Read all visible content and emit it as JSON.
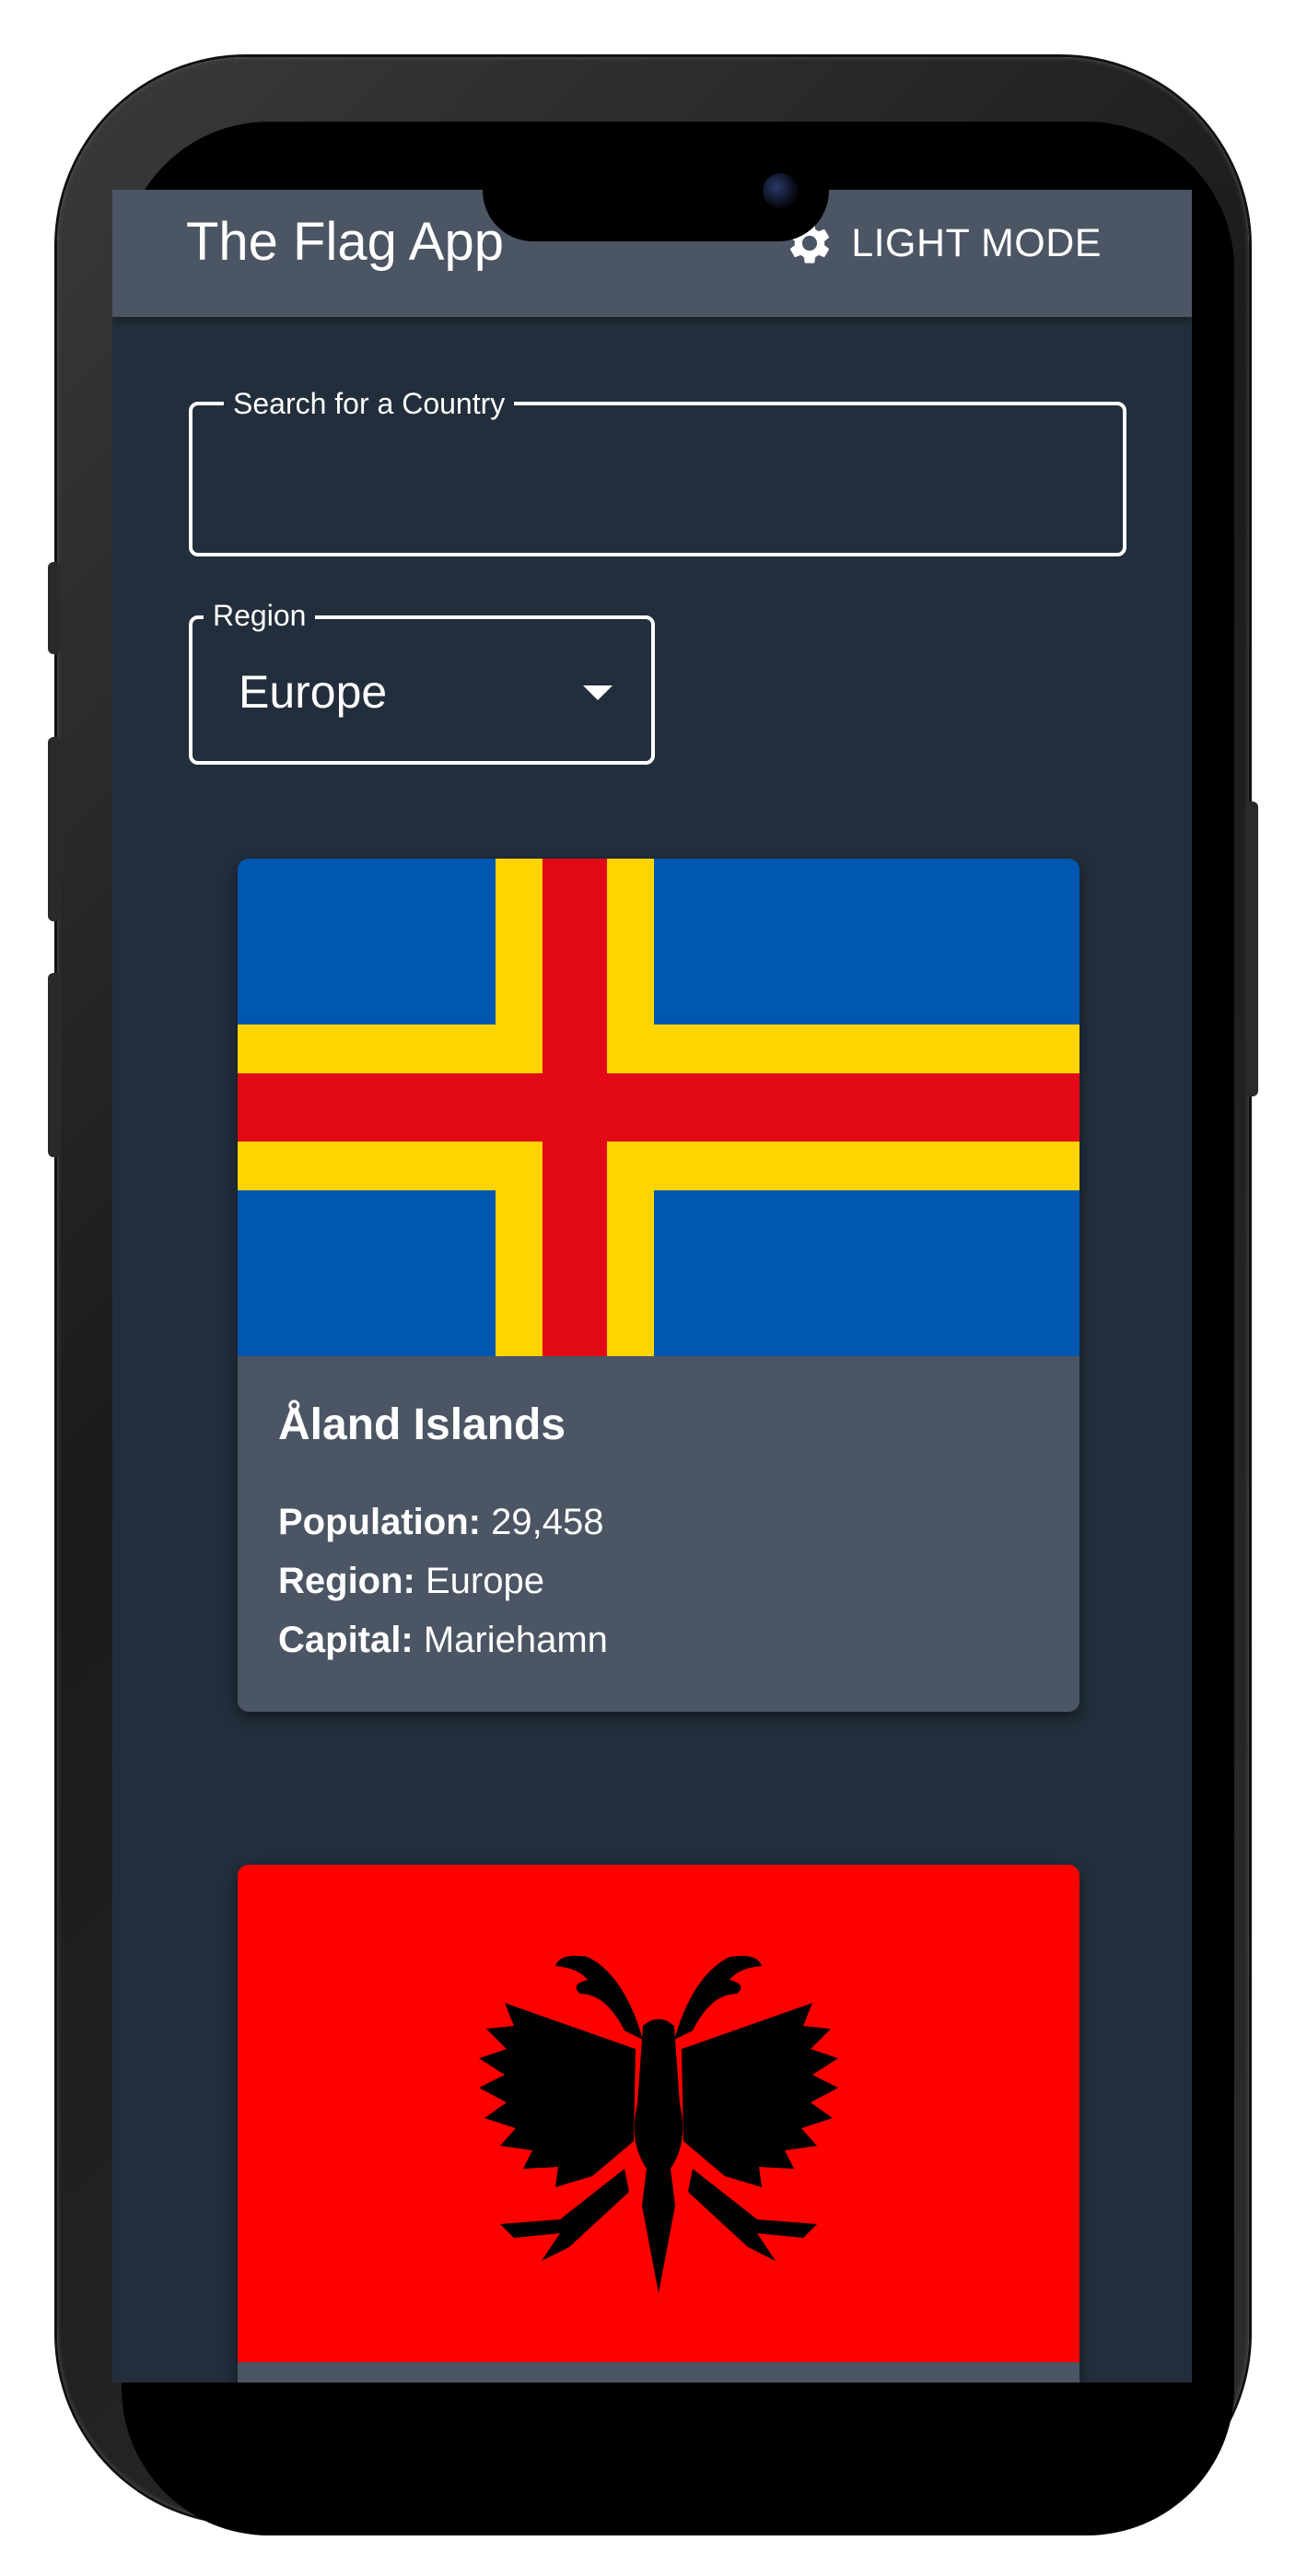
{
  "colors": {
    "background": "#222e3b",
    "appbar": "#4b5563",
    "card": "#4b5563",
    "text": "#ffffff"
  },
  "header": {
    "title": "The Flag App",
    "mode_toggle_label": "LIGHT MODE",
    "mode_toggle_icon": "gear-icon"
  },
  "search": {
    "label": "Search for a Country",
    "value": "",
    "placeholder": ""
  },
  "region_filter": {
    "label": "Region",
    "selected": "Europe",
    "icon": "caret-down-icon"
  },
  "countries": [
    {
      "name": "Åland Islands",
      "population_label": "Population:",
      "population": "29,458",
      "region_label": "Region:",
      "region": "Europe",
      "capital_label": "Capital:",
      "capital": "Mariehamn",
      "flag": "aland-islands-flag"
    },
    {
      "name": "",
      "flag": "albania-flag"
    }
  ]
}
